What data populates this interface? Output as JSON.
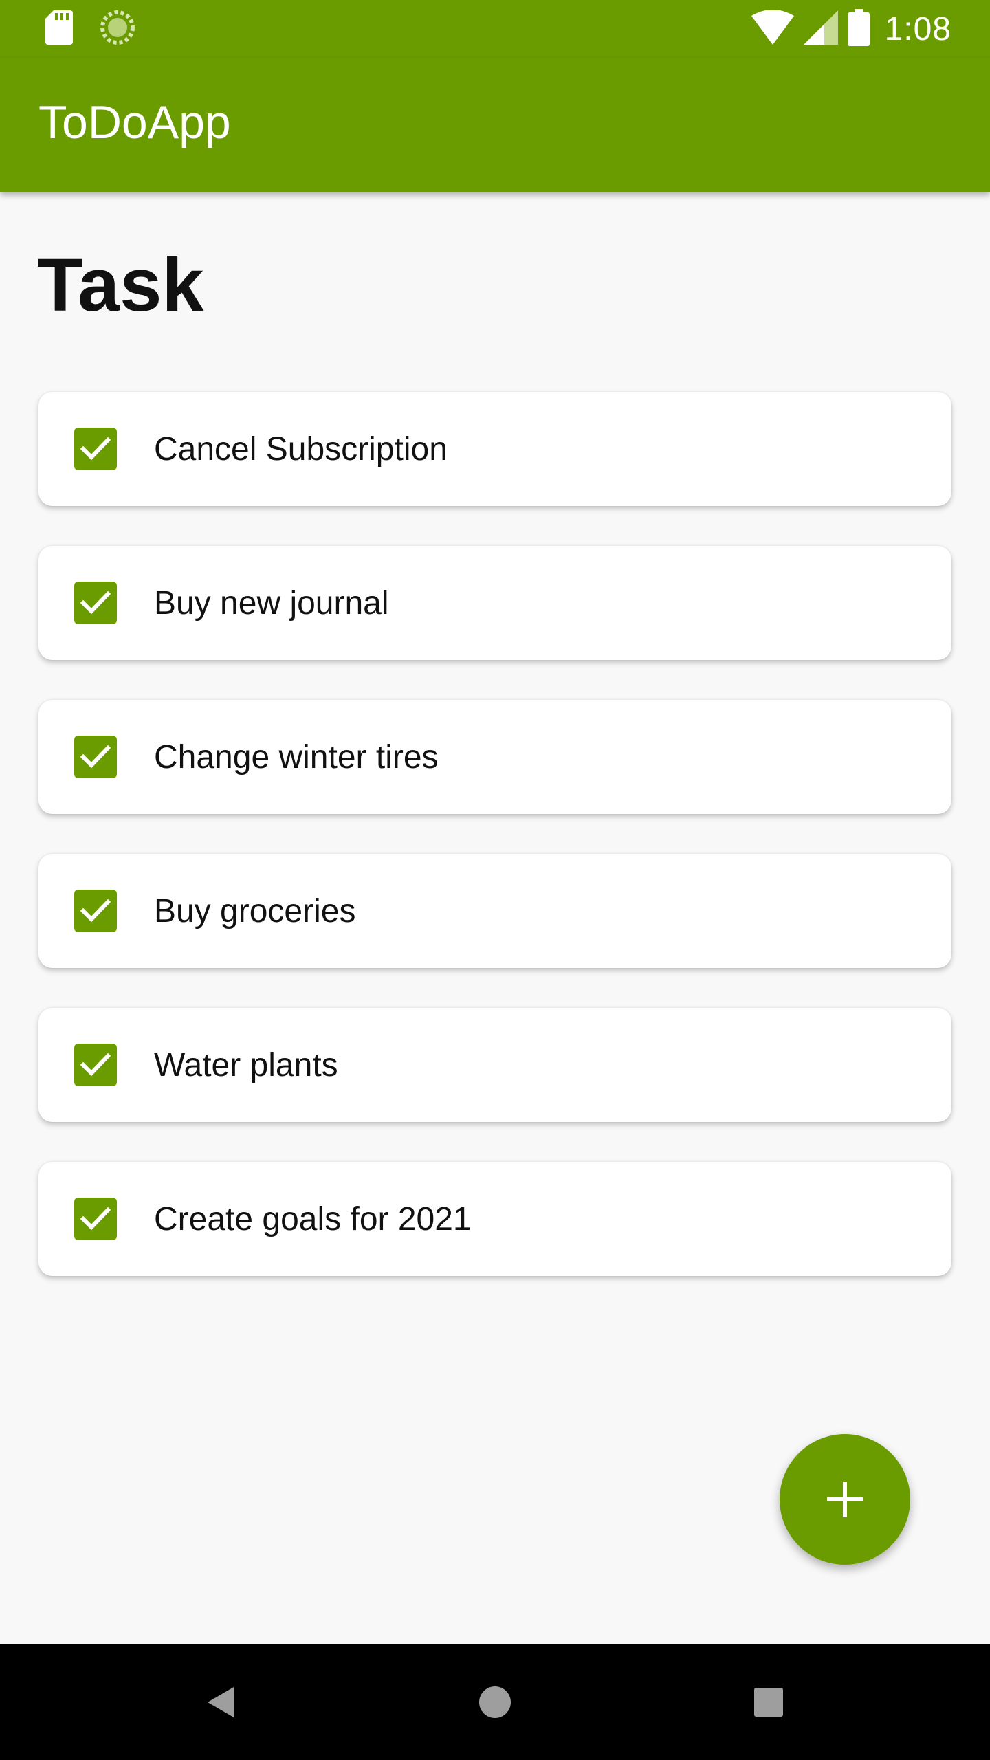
{
  "status_bar": {
    "time": "1:08",
    "icons": [
      "sd-card-icon",
      "sync-icon",
      "wifi-icon",
      "signal-icon",
      "battery-icon"
    ]
  },
  "app_bar": {
    "title": "ToDoApp"
  },
  "main": {
    "section_title": "Task",
    "tasks": [
      {
        "label": "Cancel Subscription",
        "checked": true
      },
      {
        "label": "Buy new journal",
        "checked": true
      },
      {
        "label": "Change winter tires",
        "checked": true
      },
      {
        "label": "Buy groceries",
        "checked": true
      },
      {
        "label": "Water plants",
        "checked": true
      },
      {
        "label": "Create goals for 2021",
        "checked": true
      }
    ]
  },
  "fab": {
    "icon": "plus-icon"
  },
  "nav_bar": {
    "buttons": [
      "back-icon",
      "home-icon",
      "recents-icon"
    ]
  },
  "colors": {
    "primary": "#6a9c00",
    "background": "#f8f8f8",
    "card": "#ffffff",
    "text": "#111111"
  }
}
